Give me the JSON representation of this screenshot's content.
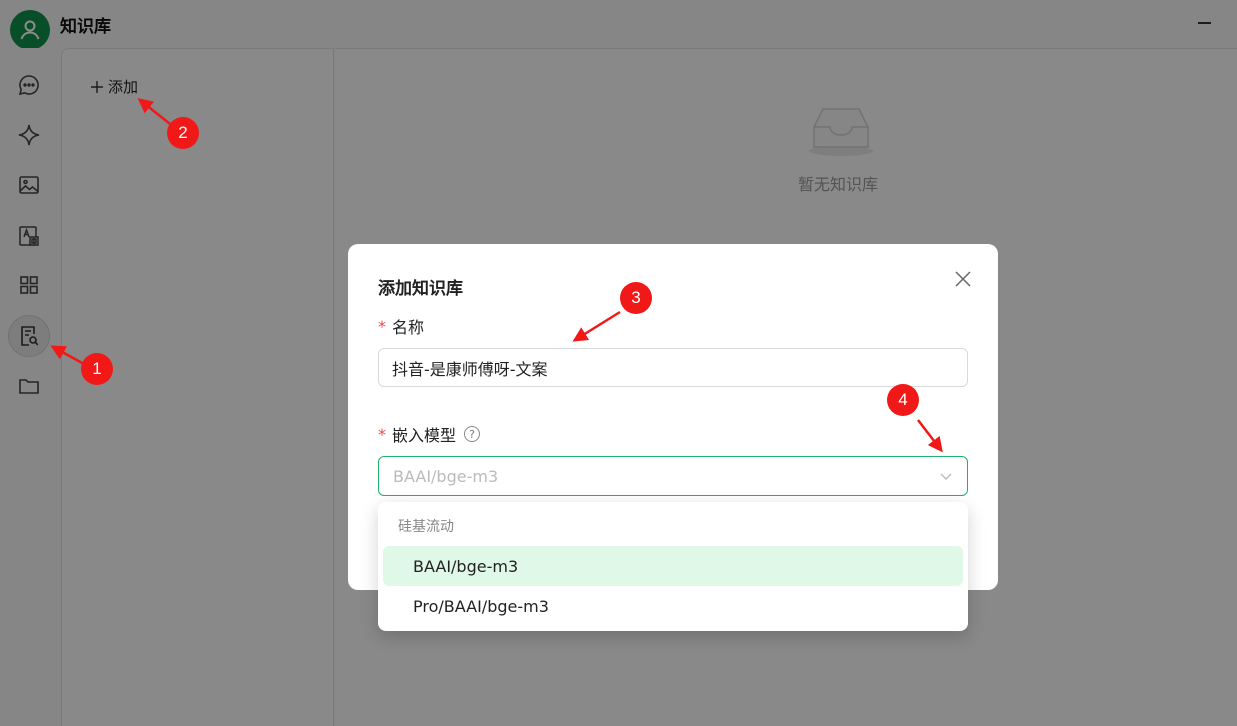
{
  "app": {
    "title": "知识库"
  },
  "sidebar": {
    "items": [
      {
        "icon": "chat-bubble-icon"
      },
      {
        "icon": "sparkle-icon"
      },
      {
        "icon": "image-icon"
      },
      {
        "icon": "translate-icon"
      },
      {
        "icon": "apps-grid-icon"
      },
      {
        "icon": "knowledge-base-icon",
        "active": true
      },
      {
        "icon": "folder-icon"
      }
    ]
  },
  "list": {
    "add_label": "添加"
  },
  "main": {
    "empty_text": "暂无知识库"
  },
  "modal": {
    "title": "添加知识库",
    "name_label": "名称",
    "name_value": "抖音-是康师傅呀-文案",
    "embed_label": "嵌入模型",
    "embed_placeholder": "BAAI/bge-m3",
    "required_mark": "*",
    "help_mark": "?"
  },
  "dropdown": {
    "group_label": "硅基流动",
    "options": [
      {
        "label": "BAAI/bge-m3",
        "selected": true
      },
      {
        "label": "Pro/BAAI/bge-m3",
        "selected": false
      }
    ]
  },
  "annotations": {
    "badges": [
      "1",
      "2",
      "3",
      "4"
    ],
    "color": "#f11818"
  },
  "colors": {
    "accent": "#1eb36b",
    "avatar": "#0f8f4a",
    "selected_bg": "#e0f8e8"
  }
}
